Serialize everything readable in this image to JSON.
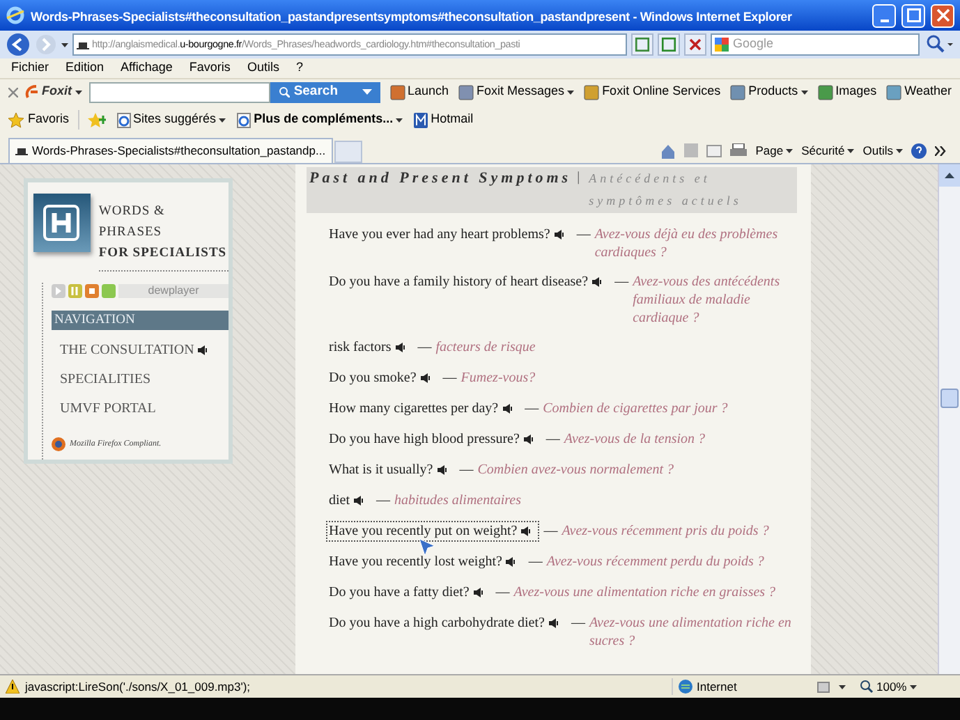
{
  "window": {
    "title": "Words-Phrases-Specialists#theconsultation_pastandpresentsymptoms#theconsultation_pastandpresent - Windows Internet Explorer"
  },
  "address_bar": {
    "url_prefix": "http://anglaismedical.",
    "url_host": "u-bourgogne.fr",
    "url_path": "/Words_Phrases/headwords_cardiology.htm#theconsultation_pasti",
    "search_placeholder": "Google"
  },
  "menu": [
    "Fichier",
    "Edition",
    "Affichage",
    "Favoris",
    "Outils",
    "?"
  ],
  "foxit_toolbar": {
    "brand": "Foxit",
    "search_button": "Search",
    "items": [
      "Launch",
      "Foxit Messages",
      "Foxit Online Services",
      "Products",
      "Images",
      "Weather"
    ]
  },
  "favorites_bar": {
    "favorites": "Favoris",
    "items": [
      {
        "label": "Sites suggérés",
        "bold": false
      },
      {
        "label": "Plus de compléments...",
        "bold": true
      },
      {
        "label": "Hotmail",
        "bold": false
      }
    ]
  },
  "tab": {
    "title": "Words-Phrases-Specialists#theconsultation_pastandp..."
  },
  "command_bar": [
    "Page",
    "Sécurité",
    "Outils"
  ],
  "sidebar": {
    "brand_line_1": "WORDS & PHRASES",
    "brand_line_2": "FOR SPECIALISTS",
    "player_label": "dewplayer",
    "nav_heading": "NAVIGATION",
    "nav_items": [
      {
        "label": "THE CONSULTATION",
        "audio": true
      },
      {
        "label": "SPECIALITIES",
        "audio": false
      },
      {
        "label": "UMVF PORTAL",
        "audio": false
      }
    ],
    "footer": "Mozilla Firefox Compliant."
  },
  "content": {
    "heading_en": "Past and Present Symptoms",
    "heading_separator": "|",
    "heading_fr": "Antécédents et symptômes actuels",
    "entries": [
      {
        "en": "Have you ever had any heart problems?",
        "fr": "Avez-vous déjà eu des problèmes cardiaques ?",
        "focused": false,
        "dash": "—"
      },
      {
        "en": "Do you have a family history of heart disease?",
        "fr": "Avez-vous des antécédents familiaux de maladie cardiaque ?",
        "focused": false,
        "dash": "—"
      },
      {
        "en": "risk factors",
        "fr": "facteurs de risque",
        "focused": false,
        "dash": "—"
      },
      {
        "en": "Do you smoke?",
        "fr": "Fumez-vous?",
        "focused": false,
        "dash": "—"
      },
      {
        "en": "How many cigarettes per day?",
        "fr": "Combien de cigarettes par jour ?",
        "focused": false,
        "dash": "—"
      },
      {
        "en": "Do you have high blood pressure?",
        "fr": "Avez-vous de la tension ?",
        "focused": false,
        "dash": "—"
      },
      {
        "en": "What is it usually?",
        "fr": "Combien avez-vous normalement ?",
        "focused": false,
        "dash": "—"
      },
      {
        "en": "diet",
        "fr": "habitudes alimentaires",
        "focused": false,
        "dash": "—"
      },
      {
        "en": "Have you recently put on weight?",
        "fr": "Avez-vous récemment pris du poids ?",
        "focused": true,
        "dash": "—"
      },
      {
        "en": "Have you recently lost weight?",
        "fr": "Avez-vous récemment perdu du poids ?",
        "focused": false,
        "dash": "—"
      },
      {
        "en": "Do you have a fatty diet?",
        "fr": "Avez-vous une alimentation riche en graisses ?",
        "focused": false,
        "dash": "—"
      },
      {
        "en": "Do you have a high carbohydrate diet?",
        "fr": "Avez-vous une alimentation riche en sucres ?",
        "focused": false,
        "dash": "—"
      }
    ]
  },
  "status_bar": {
    "text": "javascript:LireSon('./sons/X_01_009.mp3');",
    "zone": "Internet",
    "zoom": "100%"
  }
}
